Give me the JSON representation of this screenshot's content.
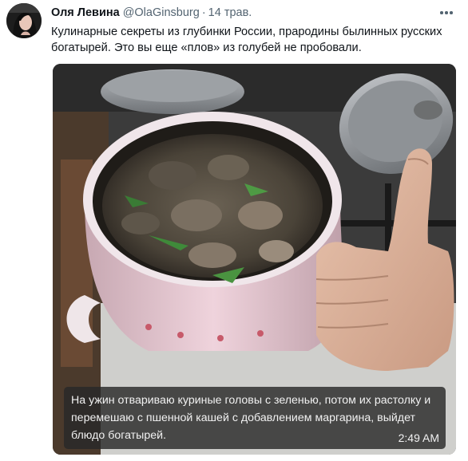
{
  "tweet": {
    "author": {
      "display_name": "Оля Левина",
      "handle": "@OlaGinsburg",
      "separator": "·",
      "date": "14 трав."
    },
    "more_icon": "more-horizontal-icon",
    "text": "Кулинарные секреты из глубинки России, прародины былинных русских богатырей. Это вы еще «плов» из голубей не пробовали.",
    "media": {
      "caption_text": "На ужин отвариваю куриные головы с зеленью, потом их растолку и перемешаю с пшенной кашей с добавлением маргарина, выйдет блюдо богатырей.",
      "caption_time": "2:49 AM"
    }
  },
  "colors": {
    "text_primary": "#0f1419",
    "text_secondary": "#536471",
    "caption_bg": "#282828",
    "pot_enamel": "#e9c8d2"
  }
}
